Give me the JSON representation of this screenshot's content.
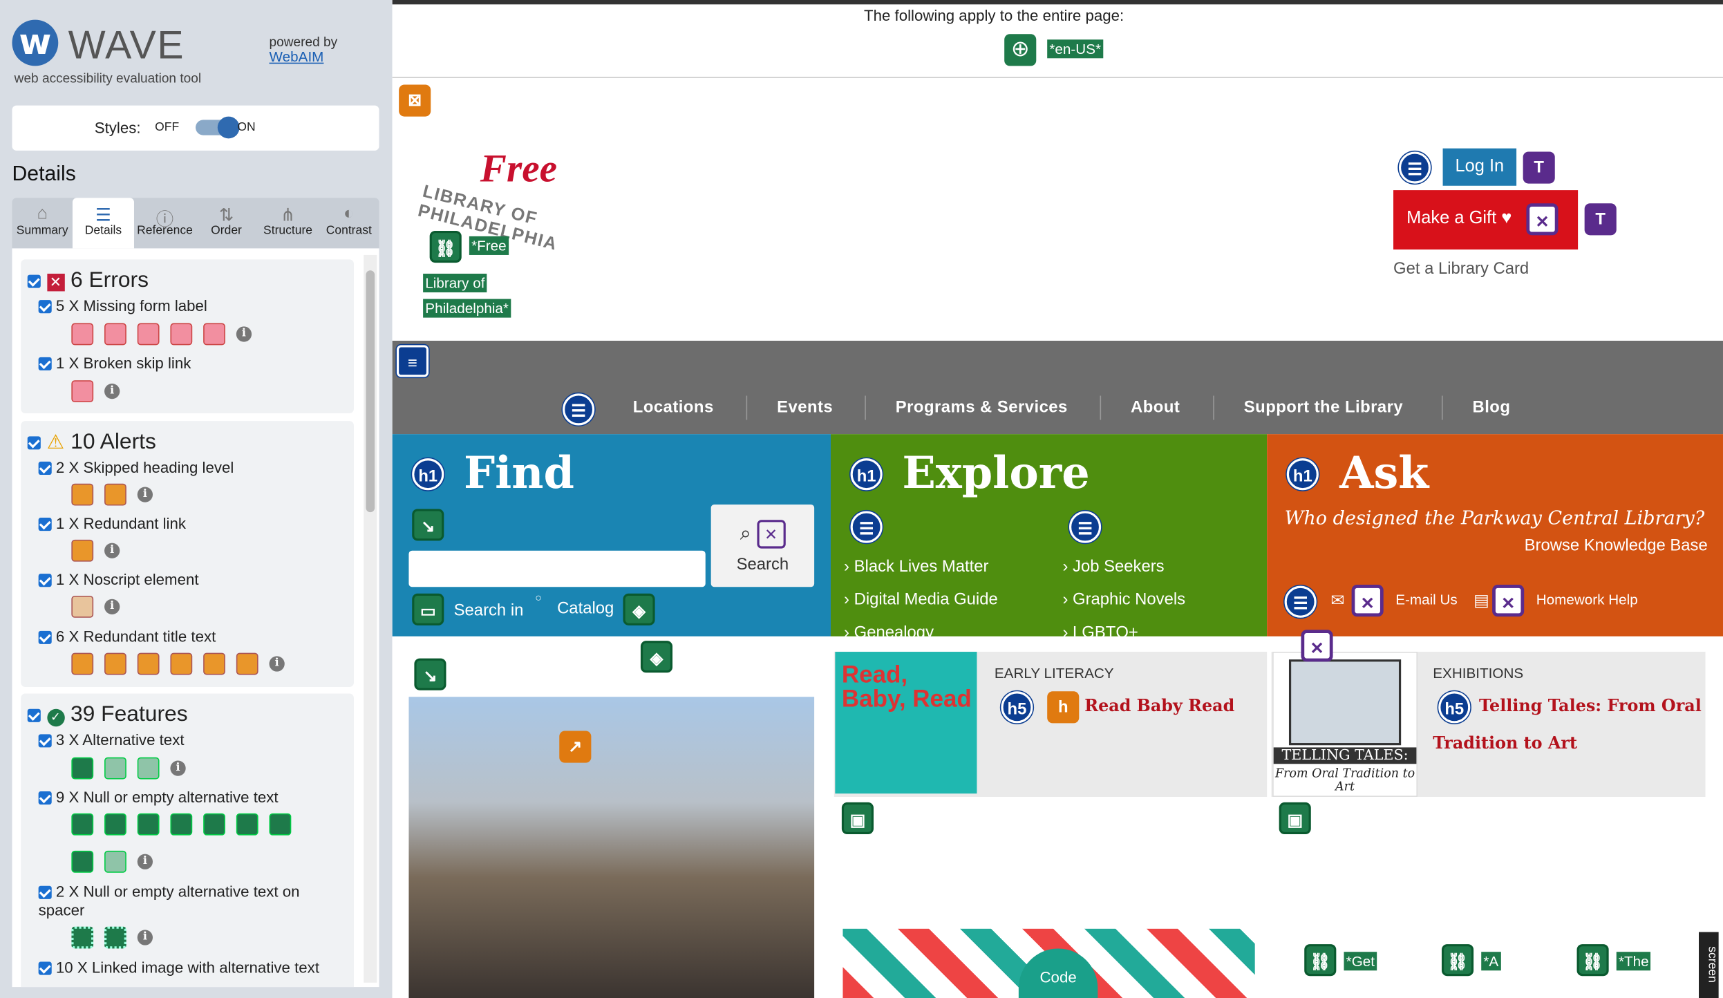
{
  "sidebar": {
    "logo_letter": "w",
    "title": "WAVE",
    "subtitle": "web accessibility evaluation tool",
    "powered_by": "powered by",
    "webaim": "WebAIM",
    "styles_label": "Styles:",
    "styles_off": "OFF",
    "styles_on": "ON",
    "details_heading": "Details",
    "tabs": [
      {
        "label": "Summary",
        "icon": "home-icon"
      },
      {
        "label": "Details",
        "icon": "list-icon"
      },
      {
        "label": "Reference",
        "icon": "info-icon"
      },
      {
        "label": "Order",
        "icon": "order-icon"
      },
      {
        "label": "Structure",
        "icon": "structure-icon"
      },
      {
        "label": "Contrast",
        "icon": "contrast-icon"
      }
    ],
    "errors": {
      "heading": "6 Errors",
      "items": [
        "5 X Missing form label",
        "1 X Broken skip link"
      ]
    },
    "alerts": {
      "heading": "10 Alerts",
      "items": [
        "2 X Skipped heading level",
        "1 X Redundant link",
        "1 X Noscript element",
        "6 X Redundant title text"
      ]
    },
    "features": {
      "heading": "39 Features",
      "items": [
        "3 X Alternative text",
        "9 X Null or empty alternative text",
        "2 X Null or empty alternative text on spacer",
        "10 X Linked image with alternative text"
      ]
    }
  },
  "page": {
    "apply_text": "The following apply to the entire page:",
    "lang": "*en-US*",
    "logo_free": "Free",
    "logo_library": "LIBRARY OF PHILADELPHIA",
    "logo_alt_lines": [
      "*Free",
      "Library of",
      "Philadelphia*"
    ],
    "login": "Log In",
    "gift": "Make a Gift",
    "library_card": "Get a Library Card",
    "nav": [
      "Locations",
      "Events",
      "Programs & Services",
      "About",
      "Support the Library",
      "Blog"
    ],
    "find": {
      "title": "Find",
      "search_btn": "Search",
      "search_in": "Search in",
      "catalog": "Catalog"
    },
    "explore": {
      "title": "Explore",
      "col1": [
        "Black Lives Matter",
        "Digital Media Guide",
        "Genealogy"
      ],
      "col2": [
        "Job Seekers",
        "Graphic Novels",
        "LGBTQ+"
      ]
    },
    "ask": {
      "title": "Ask",
      "question": "Who designed the Parkway Central Library?",
      "kb": "Browse Knowledge Base",
      "email": "E-mail Us",
      "homework": "Homework Help"
    },
    "early": {
      "tag": "EARLY LITERACY",
      "title": "Read Baby Read",
      "image_text": "Read, Baby, Read"
    },
    "exhibit": {
      "tag": "EXHIBITIONS",
      "title_1": "Telling Tales: From Oral",
      "title_2": "Tradition to Art",
      "image_title": "TELLING TALES:",
      "image_sub": "From Oral Tradition to Art"
    },
    "bottom_labels": [
      "*Get",
      "*A",
      "*The"
    ],
    "code": "Code",
    "h1": "h1",
    "h5": "h5",
    "screen_tab": "screen"
  }
}
